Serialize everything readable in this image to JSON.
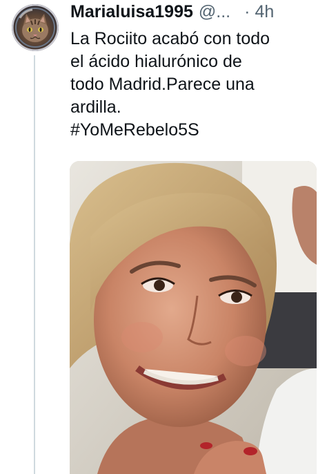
{
  "tweet": {
    "author": {
      "display_name": "Marialuisa1995",
      "handle": "@...",
      "avatar_icon": "cat-astronaut-avatar-icon"
    },
    "separator": "·",
    "timestamp": "4h",
    "text_lines": [
      "La Rociito acabó  con todo",
      "el ácido hialurónico de",
      "todo Madrid.Parece una",
      "ardilla."
    ],
    "hashtag": "#YoMeRebelo5S",
    "media": {
      "type": "photo",
      "icon": "photo-image-icon"
    }
  },
  "colors": {
    "text": "#0f1419",
    "secondary": "#536471",
    "thread_line": "#cfd9de"
  }
}
